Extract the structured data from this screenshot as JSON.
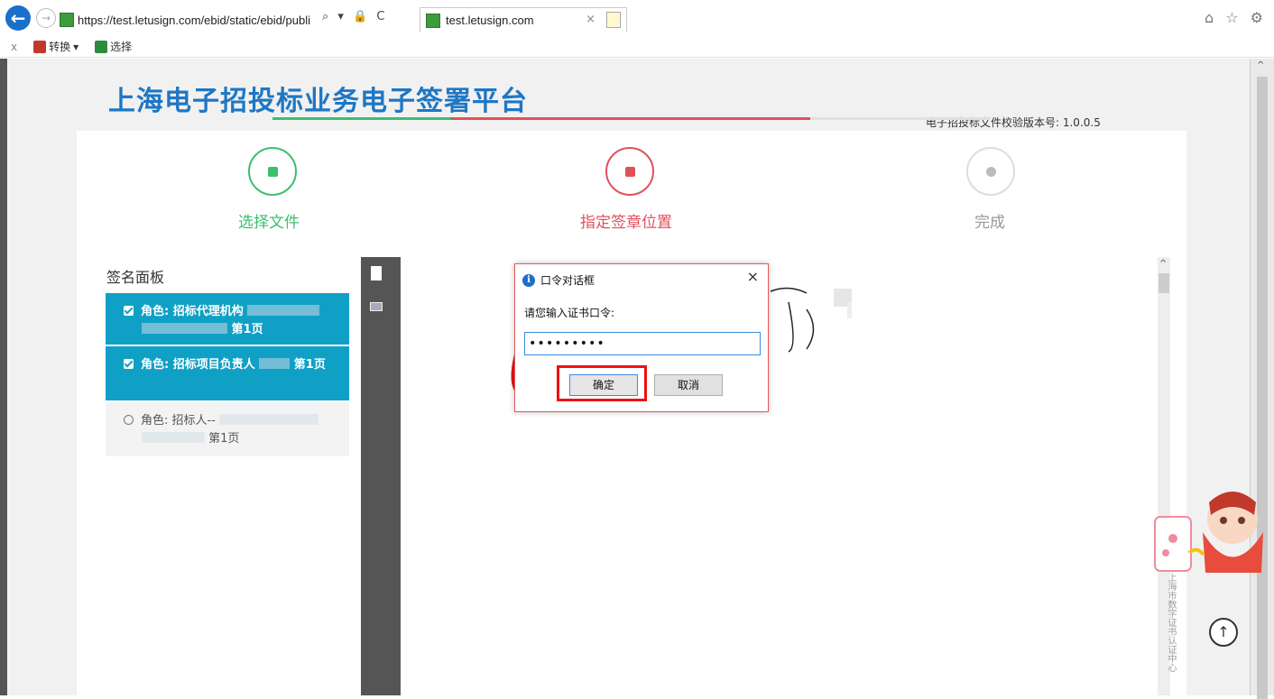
{
  "browser": {
    "url": "https://test.letusign.com/ebid/static/ebid/publi",
    "url_icons": "⌕ ▾ 🔒 C",
    "tab_title": "test.letusign.com",
    "tab_close": "×",
    "toolbar": {
      "close": "x",
      "convert_label": "转换",
      "dropdown": "▾",
      "select_label": "选择"
    },
    "right_icons": "⌂ ☆ ⚙"
  },
  "header": {
    "brand": "上海电子招投标业务电子签署平台",
    "version": "电子招投标文件校验版本号: 1.0.0.5"
  },
  "stepper": {
    "steps": [
      {
        "label": "选择文件",
        "color": "#3cbf6f"
      },
      {
        "label": "指定签章位置",
        "color": "#e2505c"
      },
      {
        "label": "完成",
        "color": "#bbbbbb"
      }
    ]
  },
  "panel": {
    "title": "签名面板",
    "roles": [
      {
        "prefix": "角色: 招标代理机构",
        "page": "第1页",
        "checked": true
      },
      {
        "prefix": "角色: 招标项目负责人",
        "page": "第1页",
        "checked": true
      },
      {
        "prefix": "角色: 招标人--",
        "page": "第1页",
        "checked": false
      }
    ]
  },
  "dialog": {
    "title": "口令对话框",
    "info_icon": "i",
    "close": "×",
    "prompt": "请您输入证书口令:",
    "password_value": "•••••••••",
    "ok_label": "确定",
    "cancel_label": "取消"
  },
  "side_text": "上海市数字证书认证中心",
  "scroll_top_label": "↑",
  "scrollbar_arrow": "^"
}
